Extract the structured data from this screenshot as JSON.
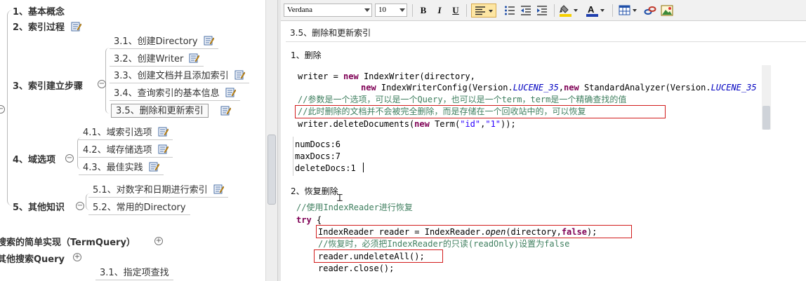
{
  "mindmap": {
    "nodes": {
      "n1": "1、基本概念",
      "n2": "2、索引过程",
      "n3": "3、索引建立步骤",
      "n31": "3.1、创建Directory",
      "n32": "3.2、创建Writer",
      "n33": "3.3、创建文档并且添加索引",
      "n34": "3.4、查询索引的基本信息",
      "n35": "3.5、删除和更新索引",
      "n4": "4、域选项",
      "n41": "4.1、域索引选项",
      "n42": "4.2、域存储选项",
      "n43": "4.3、最佳实践",
      "n5": "5、其他知识",
      "n51": "5.1、对数字和日期进行索引",
      "n52": "5.2、常用的Directory",
      "search_simple": "搜索的简单实现（TermQuery）",
      "search_other": "其他搜索Query",
      "n_specify": "3.1、指定项查找"
    },
    "toggle_expanded": "−",
    "toggle_collapsed": "+"
  },
  "toolbar": {
    "font_family": "Verdana",
    "font_size": "10",
    "bold": "B",
    "italic": "I",
    "underline": "U",
    "highlight_color": "#f6d000",
    "font_color": "#1f3fae"
  },
  "editor": {
    "title": "3.5、删除和更新索引",
    "section1_heading": "1、删除",
    "code1": {
      "l0": "`",
      "l1_a": "writer = ",
      "l1_kw": "new",
      "l1_b": " IndexWriter(directory,",
      "l2_kw": "new",
      "l2_a": " IndexWriterConfig(Version.",
      "l2_c": "LUCENE_35",
      "l2_b": ",",
      "l2_kw2": "new",
      "l2_d": " StandardAnalyzer(Version.",
      "l2_e": "LUCENE_35",
      "comment1": "//参数是一个选项，可以是一个Query，也可以是一个term，term是一个精确查找的值",
      "comment2": "//此时删除的文档并不会被完全删除，而是存储在一个回收站中的，可以恢复",
      "l5_a": "writer.deleteDocuments(",
      "l5_kw": "new",
      "l5_b": " Term(",
      "l5_s1": "\"id\"",
      "l5_c": ",",
      "l5_s2": "\"1\"",
      "l5_d": "));"
    },
    "counts": {
      "numDocs": "numDocs:6",
      "maxDocs": "maxDocs:7",
      "deleteDocs": "deleteDocs:1"
    },
    "section2_heading": "2、恢复删除",
    "code2": {
      "comment1": "//使用IndexReader进行恢复",
      "try_kw": "try",
      "try_brace": " {",
      "l2_a": "IndexReader reader = IndexReader.",
      "l2_m": "open",
      "l2_b": "(directory,",
      "l2_kw": "false",
      "l2_c": ");",
      "comment2": "//恢复时，必须把IndexReader的只读(readOnly)设置为false",
      "l4": "reader.undeleteAll();",
      "l5": "reader.close();"
    },
    "ibeam": "Ɪ"
  }
}
